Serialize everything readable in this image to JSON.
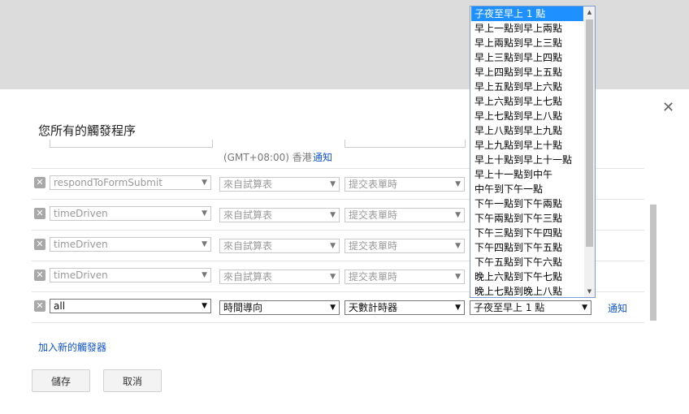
{
  "dialog": {
    "title": "您所有的觸發程序",
    "timezone": "(GMT+08:00) 香港",
    "notify_label": "通知",
    "add_trigger_label": "加入新的觸發器",
    "save_label": "儲存",
    "cancel_label": "取消"
  },
  "triggers": [
    {
      "function": "respondToFormSubmit",
      "source": "來自試算表",
      "event": "提交表單時",
      "active": false
    },
    {
      "function": "timeDriven",
      "source": "來自試算表",
      "event": "提交表單時",
      "active": false
    },
    {
      "function": "timeDriven",
      "source": "來自試算表",
      "event": "提交表單時",
      "active": false
    },
    {
      "function": "timeDriven",
      "source": "來自試算表",
      "event": "提交表單時",
      "active": false
    },
    {
      "function": "all",
      "source": "時間導向",
      "event": "天數計時器",
      "time": "子夜至早上 1 點",
      "active": true
    }
  ],
  "time_dropdown": {
    "selected_index": 0,
    "options": [
      "子夜至早上 1 點",
      "早上一點到早上兩點",
      "早上兩點到早上三點",
      "早上三點到早上四點",
      "早上四點到早上五點",
      "早上五點到早上六點",
      "早上六點到早上七點",
      "早上七點到早上八點",
      "早上八點到早上九點",
      "早上九點到早上十點",
      "早上十點到早上十一點",
      "早上十一點到中午",
      "中午到下午一點",
      "下午一點到下午兩點",
      "下午兩點到下午三點",
      "下午三點到下午四點",
      "下午四點到下午五點",
      "下午五點到下午六點",
      "晚上六點到下午七點",
      "晚上七點到晚上八點"
    ]
  },
  "icons": {
    "close": "close-icon",
    "delete": "delete-icon",
    "dropdown": "chevron-down-icon"
  }
}
